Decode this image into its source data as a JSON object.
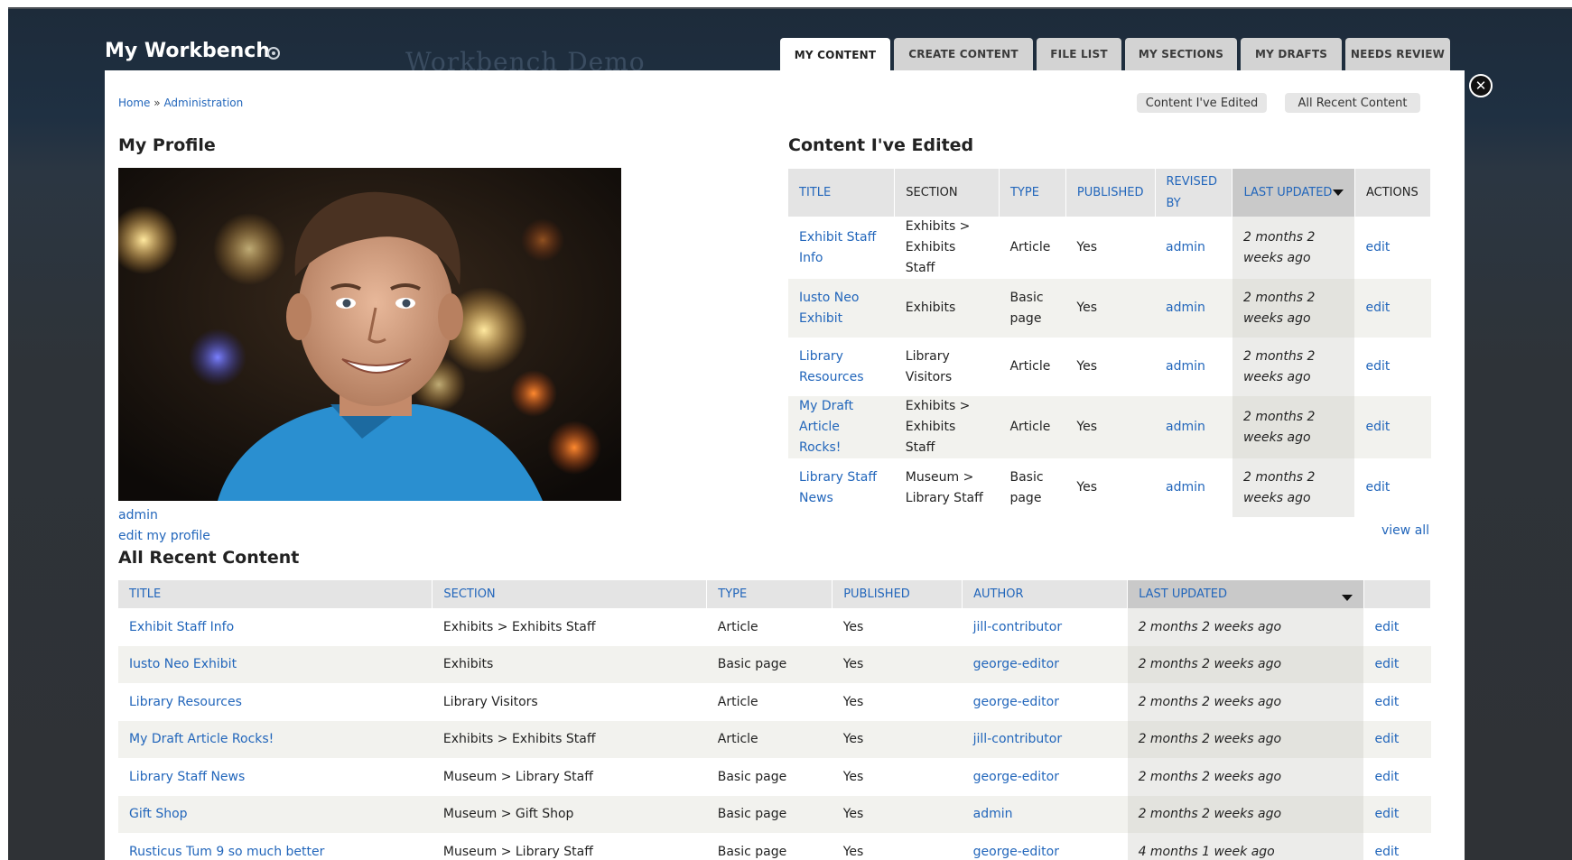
{
  "overlay": {
    "title": "My Workbench",
    "site_name": "Workbench Demo",
    "close_symbol": "✕"
  },
  "tabs": [
    {
      "label": "My Content",
      "active": true
    },
    {
      "label": "Create Content",
      "active": false
    },
    {
      "label": "File List",
      "active": false
    },
    {
      "label": "My Sections",
      "active": false
    },
    {
      "label": "My Drafts",
      "active": false
    },
    {
      "label": "Needs Review",
      "active": false
    }
  ],
  "breadcrumb": {
    "home": "Home",
    "separator": "»",
    "admin": "Administration"
  },
  "shortcuts": {
    "edited": "Content I've Edited",
    "recent": "All Recent Content"
  },
  "profile": {
    "heading": "My Profile",
    "username": "admin",
    "edit_link": "edit my profile"
  },
  "edited": {
    "heading": "Content I've Edited",
    "columns": [
      "Title",
      "Section",
      "Type",
      "Published",
      "Revised by",
      "Last updated",
      "Actions"
    ],
    "rows": [
      {
        "title": "Exhibit Staff Info",
        "section": "Exhibits > Exhibits Staff",
        "type": "Article",
        "published": "Yes",
        "revised_by": "admin",
        "updated": "2 months 2 weeks ago",
        "action": "edit"
      },
      {
        "title": "Iusto Neo Exhibit",
        "section": "Exhibits",
        "type": "Basic page",
        "published": "Yes",
        "revised_by": "admin",
        "updated": "2 months 2 weeks ago",
        "action": "edit"
      },
      {
        "title": "Library Resources",
        "section": "Library Visitors",
        "type": "Article",
        "published": "Yes",
        "revised_by": "admin",
        "updated": "2 months 2 weeks ago",
        "action": "edit"
      },
      {
        "title": "My Draft Article Rocks!",
        "section": "Exhibits > Exhibits Staff",
        "type": "Article",
        "published": "Yes",
        "revised_by": "admin",
        "updated": "2 months 2 weeks ago",
        "action": "edit"
      },
      {
        "title": "Library Staff News",
        "section": "Museum > Library Staff",
        "type": "Basic page",
        "published": "Yes",
        "revised_by": "admin",
        "updated": "2 months 2 weeks ago",
        "action": "edit"
      }
    ],
    "view_all": "view all"
  },
  "recent": {
    "heading": "All Recent Content",
    "columns": [
      "Title",
      "Section",
      "Type",
      "Published",
      "Author",
      "Last updated",
      ""
    ],
    "rows": [
      {
        "title": "Exhibit Staff Info",
        "section": "Exhibits > Exhibits Staff",
        "type": "Article",
        "published": "Yes",
        "author": "jill-contributor",
        "updated": "2 months 2 weeks ago",
        "action": "edit"
      },
      {
        "title": "Iusto Neo Exhibit",
        "section": "Exhibits",
        "type": "Basic page",
        "published": "Yes",
        "author": "george-editor",
        "updated": "2 months 2 weeks ago",
        "action": "edit"
      },
      {
        "title": "Library Resources",
        "section": "Library Visitors",
        "type": "Article",
        "published": "Yes",
        "author": "george-editor",
        "updated": "2 months 2 weeks ago",
        "action": "edit"
      },
      {
        "title": "My Draft Article Rocks!",
        "section": "Exhibits > Exhibits Staff",
        "type": "Article",
        "published": "Yes",
        "author": "jill-contributor",
        "updated": "2 months 2 weeks ago",
        "action": "edit"
      },
      {
        "title": "Library Staff News",
        "section": "Museum > Library Staff",
        "type": "Basic page",
        "published": "Yes",
        "author": "george-editor",
        "updated": "2 months 2 weeks ago",
        "action": "edit"
      },
      {
        "title": "Gift Shop",
        "section": "Museum > Gift Shop",
        "type": "Basic page",
        "published": "Yes",
        "author": "admin",
        "updated": "2 months 2 weeks ago",
        "action": "edit"
      },
      {
        "title": "Rusticus Tum 9 so much better",
        "section": "Museum > Library Staff",
        "type": "Basic page",
        "published": "Yes",
        "author": "george-editor",
        "updated": "4 months 1 week ago",
        "action": "edit"
      }
    ]
  },
  "colors": {
    "link": "#2266bb",
    "header_bg": "#e4e4e4",
    "sorted_bg": "#c9c9c9",
    "even_row": "#f2f2ee"
  }
}
